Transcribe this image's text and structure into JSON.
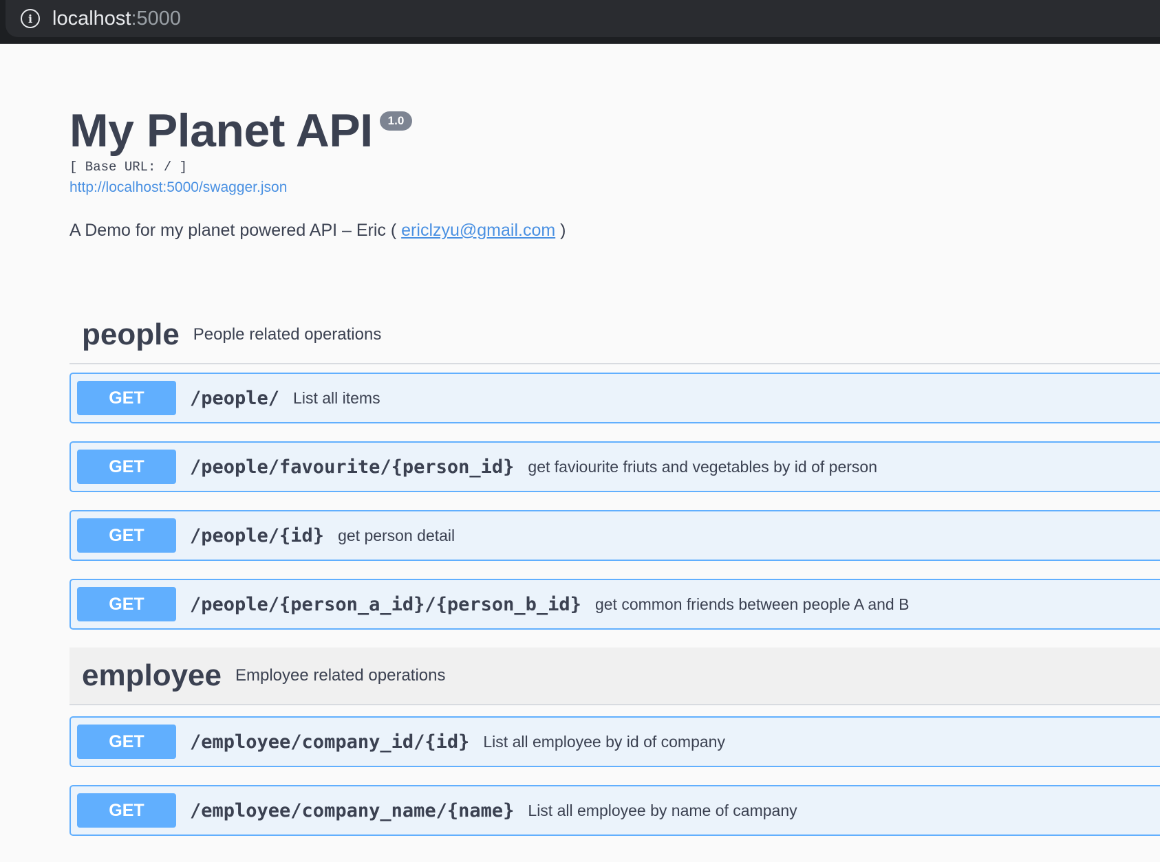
{
  "browser": {
    "host": "localhost",
    "port": ":5000",
    "info_icon": "info-icon"
  },
  "info": {
    "title": "My Planet API",
    "version": "1.0",
    "base_url": "[ Base URL: / ]",
    "spec_link": "http://localhost:5000/swagger.json",
    "description_prefix": "A Demo for my planet powered API – Eric ( ",
    "contact_email": "ericlzyu@gmail.com",
    "description_suffix": " )"
  },
  "tags": [
    {
      "name": "people",
      "description": "People related operations",
      "operations": [
        {
          "method": "GET",
          "path": "/people/",
          "summary": "List all items"
        },
        {
          "method": "GET",
          "path": "/people/favourite/{person_id}",
          "summary": "get faviourite friuts and vegetables by id of person"
        },
        {
          "method": "GET",
          "path": "/people/{id}",
          "summary": "get person detail"
        },
        {
          "method": "GET",
          "path": "/people/{person_a_id}/{person_b_id}",
          "summary": "get common friends between people A and B"
        }
      ]
    },
    {
      "name": "employee",
      "description": "Employee related operations",
      "operations": [
        {
          "method": "GET",
          "path": "/employee/company_id/{id}",
          "summary": "List all employee by id of company"
        },
        {
          "method": "GET",
          "path": "/employee/company_name/{name}",
          "summary": "List all employee by name of campany"
        }
      ]
    }
  ],
  "colors": {
    "get_accent": "#61affe",
    "get_background": "#ebf3fb",
    "text": "#3b4151",
    "link": "#4990e2"
  }
}
